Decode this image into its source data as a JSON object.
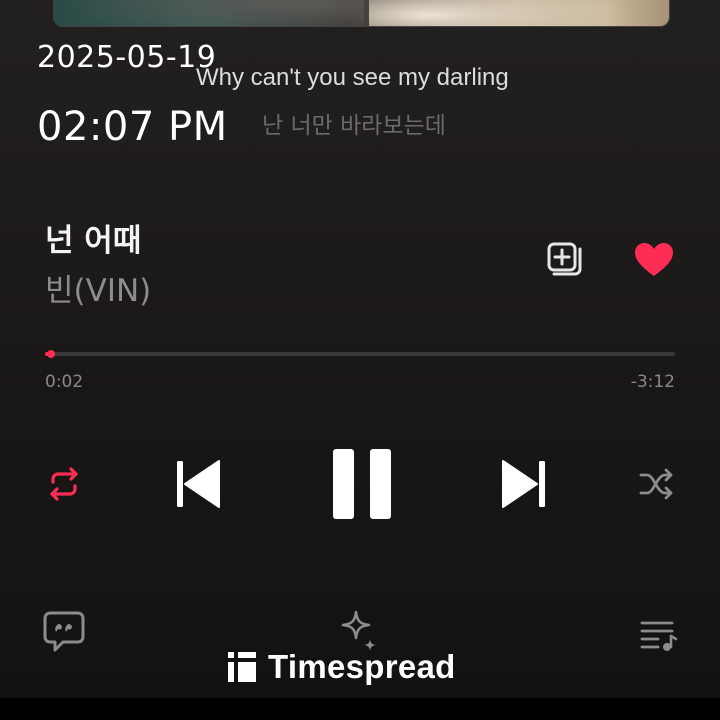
{
  "overlay": {
    "date": "2025-05-19",
    "time": "02:07 PM"
  },
  "lyrics": {
    "current": "Why can't you see my darling",
    "next": "난 너만 바라보는데"
  },
  "track": {
    "title": "넌 어때",
    "artist": "빈(VIN)",
    "liked": true
  },
  "progress": {
    "elapsed": "0:02",
    "remaining": "-3:12",
    "fraction": 0.01
  },
  "controls": {
    "repeat_icon": "repeat-icon",
    "prev_icon": "skip-previous-icon",
    "play_state_icon": "pause-icon",
    "next_icon": "skip-next-icon",
    "shuffle_icon": "shuffle-icon"
  },
  "bottom": {
    "lyrics_icon": "lyrics-quote-icon",
    "ai_icon": "sparkle-icon",
    "queue_icon": "playlist-icon"
  },
  "watermark": {
    "text": "Timespread"
  },
  "colors": {
    "accent": "#ff2d55",
    "background": "#1e1b1b",
    "icon_gray": "#8e8c8a",
    "text_white": "#ffffff"
  }
}
